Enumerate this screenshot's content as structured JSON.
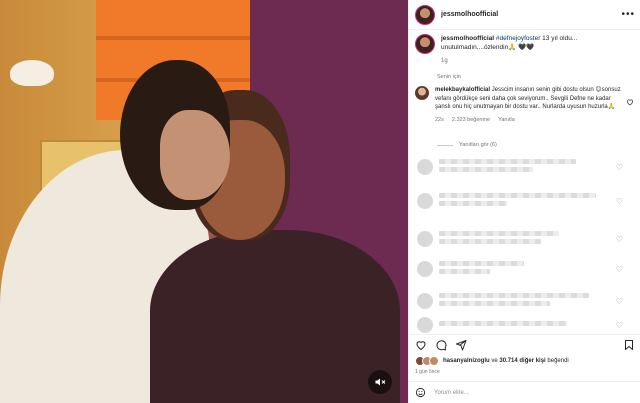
{
  "post": {
    "username": "jessmolhoofficial",
    "more_label": "•••",
    "caption": {
      "username": "jessmolhoofficial",
      "hashtag": "#defnejoyfoster",
      "text": " 13 yıl oldu... unutulmadın....özlendin🙏 🖤🖤",
      "time": "1g"
    },
    "section_label": "Senin için",
    "top_comment": {
      "username": "melekbaykalofficial",
      "text": "Jesscim insanın senin gibi dostu olsun 😊sonsuz vefanı gördükçe seni daha çok seviyorum.. Sevgili Defne ne kadar şanslı onu hiç unutmayan bir dostu var.. Nurlarda uyusun huzurla🙏",
      "time": "22s",
      "likes": "2.323 beğenme",
      "reply": "Yanıtla"
    },
    "replies_label": "Yanıtları gör (6)",
    "liked_by": {
      "user": "hasanyalnizoglu",
      "connector": " ve ",
      "others": "30.714 diğer kişi",
      "suffix": " beğendi"
    },
    "posted_ago": "1 gün önce",
    "comment_placeholder": "Yorum ekle..."
  },
  "icons": {
    "mute": "speaker-muted-icon",
    "heart": "heart-icon",
    "comment": "comment-icon",
    "share": "share-icon",
    "save": "bookmark-icon",
    "emoji": "emoji-icon",
    "more": "more-icon"
  },
  "colors": {
    "story_ring": "#d62976",
    "hashtag": "#00376b",
    "muted_text": "#737373"
  }
}
